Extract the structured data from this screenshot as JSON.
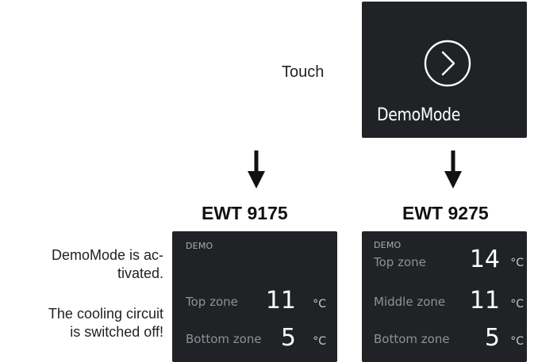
{
  "touch_label": "Touch",
  "demo_mode_tile": {
    "label": "DemoMode",
    "icon": "chevron-right-circle-icon"
  },
  "arrows": [
    "arrow-down-icon",
    "arrow-down-icon"
  ],
  "models": [
    {
      "name": "EWT 9175",
      "demo_label": "DEMO",
      "zones": [
        {
          "name": "Top zone",
          "value": "11",
          "unit": "°C"
        },
        {
          "name": "Bottom zone",
          "value": "5",
          "unit": "°C"
        }
      ]
    },
    {
      "name": "EWT 9275",
      "demo_label": "DEMO",
      "zones": [
        {
          "name": "Top zone",
          "value": "14",
          "unit": "°C"
        },
        {
          "name": "Middle zone",
          "value": "11",
          "unit": "°C"
        },
        {
          "name": "Bottom zone",
          "value": "5",
          "unit": "°C"
        }
      ]
    }
  ],
  "side_notes": {
    "line1a": "DemoMode is ac-",
    "line1b": "tivated.",
    "line2a": "The cooling circuit",
    "line2b": "is switched off!"
  },
  "colors": {
    "panel_bg": "#202226",
    "text_white": "#ffffff",
    "label_gray": "#8d9298"
  }
}
